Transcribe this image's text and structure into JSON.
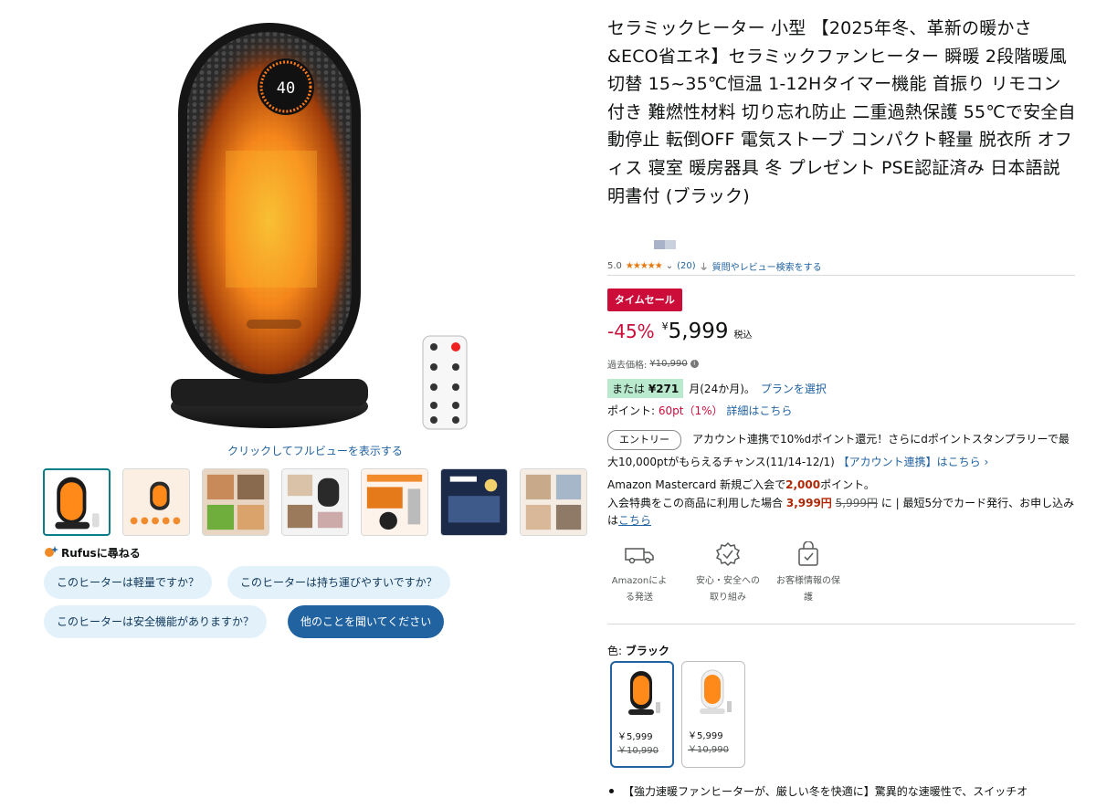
{
  "image": {
    "display_value": "40",
    "caption": "クリックしてフルビューを表示する"
  },
  "rufus": {
    "title": "Rufusに尋ねる",
    "questions": [
      "このヒーターは軽量ですか？",
      "このヒーターは持ち運びやすいですか？",
      "このヒーターは安全機能がありますか？"
    ],
    "ask_other": "他のことを聞いてください"
  },
  "product": {
    "title": "セラミックヒーター 小型 【2025年冬、革新の暖かさ&ECO省エネ】セラミックファンヒーター 瞬暖 2段階暖風切替 15~35℃恒温 1-12Hタイマー機能 首振り リモコン付き 難燃性材料 切り忘れ防止 二重過熱保護 55℃で安全自動停止 転倒OFF 電気ストーブ コンパクト軽量 脱衣所 オフィス 寝室 暖房器具 冬 プレゼント PSE認証済み 日本語説明書付 (ブラック)",
    "rating": "5.0",
    "rating_stars": 5,
    "review_count": "(20)",
    "search_reviews": "質問やレビュー検索をする"
  },
  "deal": {
    "badge": "タイムセール",
    "discount": "-45%",
    "currency": "¥",
    "price": "5,999",
    "tax": "税込",
    "list_price_label": "過去価格:",
    "list_price": "¥10,990",
    "installment_prefix": "または",
    "installment_amount": "¥271",
    "installment_suffix": "月(24か月)。",
    "installment_link": "プランを選択",
    "points_label": "ポイント:",
    "points_value": "60pt（1%）",
    "points_link": "詳細はこちら"
  },
  "entry": {
    "button": "エントリー",
    "text": "アカウント連携で10%dポイント還元！さらにdポイントスタンプラリーで最大10,000ptがもらえるチャンス(11/14-12/1)",
    "link": "【アカウント連携】はこちら ›"
  },
  "card_offer": {
    "line1_prefix": "Amazon Mastercard 新規ご入会で",
    "line1_points": "2,000",
    "line1_suffix": "ポイント。",
    "line2_prefix": "入会特典をこの商品に利用した場合",
    "line2_price": "3,999円",
    "line2_original": "5,999円",
    "line2_suffix": "に | 最短5分でカード発行、お申し込みは",
    "link": "こちら"
  },
  "features": [
    {
      "label": "Amazonによる発送",
      "icon": "delivery-truck-icon"
    },
    {
      "label": "安心・安全への取り組み",
      "icon": "safety-badge-icon"
    },
    {
      "label": "お客様情報の保護",
      "icon": "secure-bag-icon"
    }
  ],
  "color": {
    "label": "色:",
    "selected": "ブラック",
    "variants": [
      {
        "price": "￥5,999",
        "list": "￥10,990"
      },
      {
        "price": "￥5,999",
        "list": "￥10,990"
      }
    ]
  },
  "bullet": "【強力速暖ファンヒーターが、厳しい冬を快適に】驚異的な速暖性で、スイッチオ",
  "colors": {
    "link": "#2162a1",
    "deal_red": "#cc0c39",
    "star": "#e47911",
    "selected_thumb": "#0b7d88"
  }
}
